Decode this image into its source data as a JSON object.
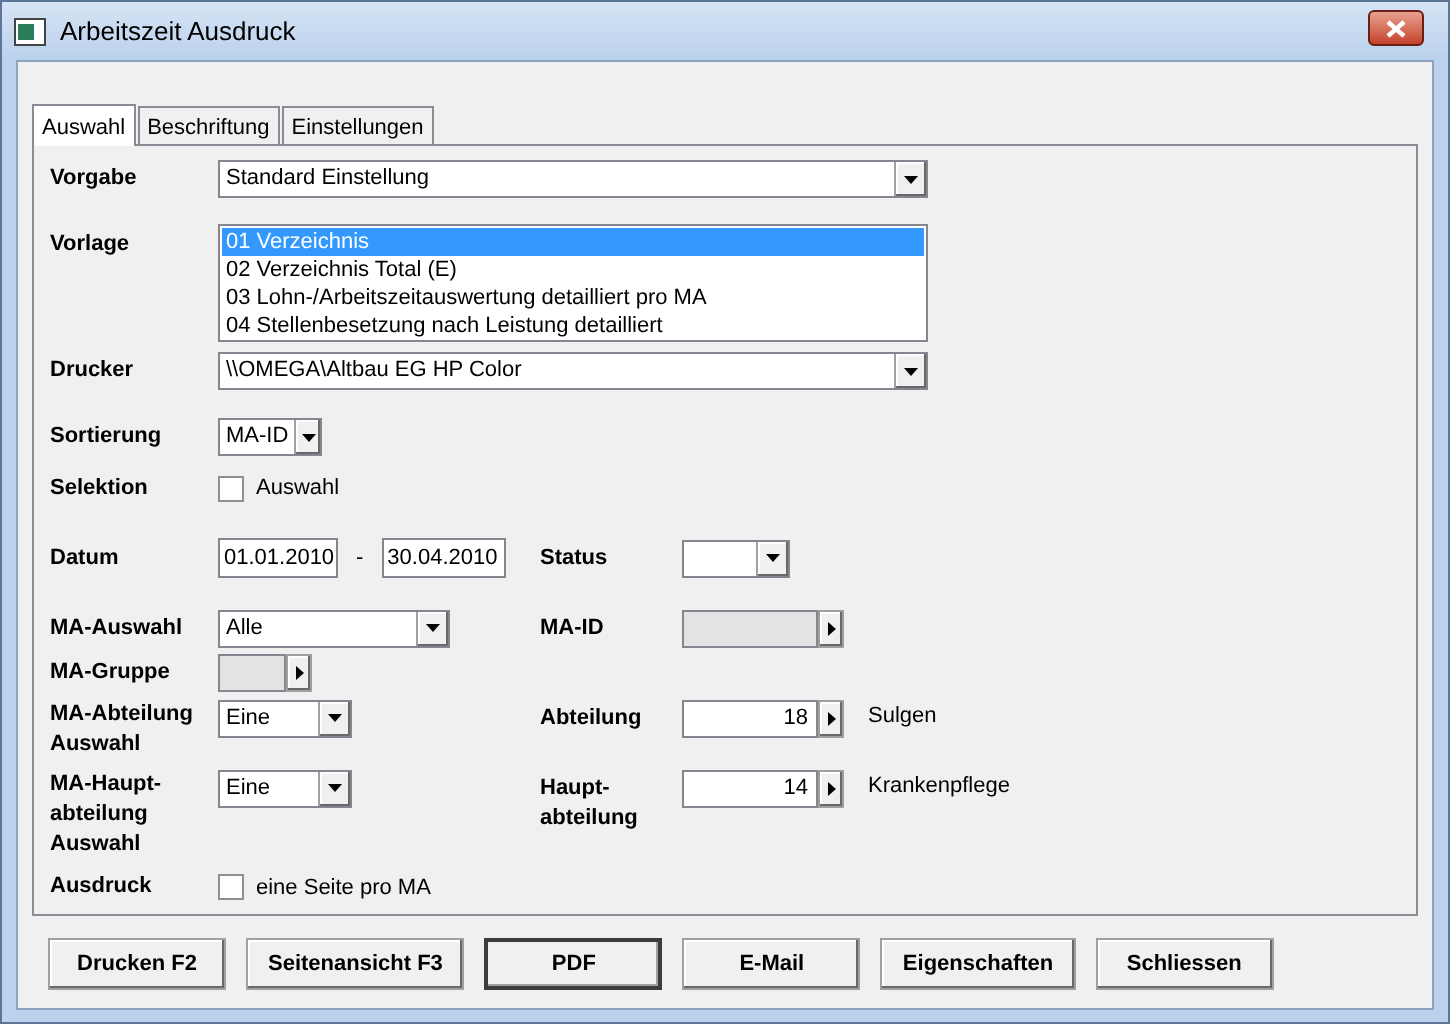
{
  "window": {
    "title": "Arbeitszeit Ausdruck"
  },
  "tabs": [
    {
      "label": "Auswahl",
      "selected": true
    },
    {
      "label": "Beschriftung",
      "selected": false
    },
    {
      "label": "Einstellungen",
      "selected": false
    }
  ],
  "vorgabe": {
    "label": "Vorgabe",
    "value": "Standard Einstellung"
  },
  "vorlage": {
    "label": "Vorlage",
    "items": [
      {
        "label": "01 Verzeichnis",
        "selected": true
      },
      {
        "label": "02 Verzeichnis Total (E)",
        "selected": false
      },
      {
        "label": "03 Lohn-/Arbeitszeitauswertung detailliert pro MA",
        "selected": false
      },
      {
        "label": "04 Stellenbesetzung nach Leistung detailliert",
        "selected": false
      }
    ]
  },
  "drucker": {
    "label": "Drucker",
    "value": "\\\\OMEGA\\Altbau EG HP Color"
  },
  "sortierung": {
    "label": "Sortierung",
    "value": "MA-ID"
  },
  "selektion": {
    "label": "Selektion",
    "option": {
      "label": "Auswahl",
      "checked": false
    }
  },
  "datum": {
    "label": "Datum",
    "from": "01.01.2010",
    "separator": "-",
    "to": "30.04.2010"
  },
  "status": {
    "label": "Status"
  },
  "ma_auswahl": {
    "label": "MA-Auswahl",
    "value": "Alle"
  },
  "ma_id": {
    "label": "MA-ID",
    "disabled": true
  },
  "ma_gruppe": {
    "label": "MA-Gruppe",
    "disabled": true
  },
  "ma_abteilung": {
    "lines": [
      "MA-Abteilung",
      "Auswahl"
    ],
    "value": "Eine"
  },
  "abteilung": {
    "label": "Abteilung",
    "value": "18",
    "disabled": false,
    "name": "Sulgen"
  },
  "ma_hauptabteilung": {
    "lines": [
      "MA-Haupt-",
      "abteilung",
      "Auswahl"
    ],
    "value": "Eine"
  },
  "hauptabteilung": {
    "lines": [
      "Haupt-",
      "abteilung"
    ],
    "value": "14",
    "disabled": false,
    "name": "Krankenpflege"
  },
  "ausdruck": {
    "label": "Ausdruck",
    "option": {
      "label": "eine Seite pro MA",
      "checked": false
    }
  },
  "buttons": [
    {
      "label": "Drucken F2",
      "default": false
    },
    {
      "label": "Seitenansicht F3",
      "default": false
    },
    {
      "label": "PDF",
      "default": true
    },
    {
      "label": "E-Mail",
      "default": false
    },
    {
      "label": "Eigenschaften",
      "default": false
    },
    {
      "label": "Schliessen",
      "default": false
    }
  ]
}
